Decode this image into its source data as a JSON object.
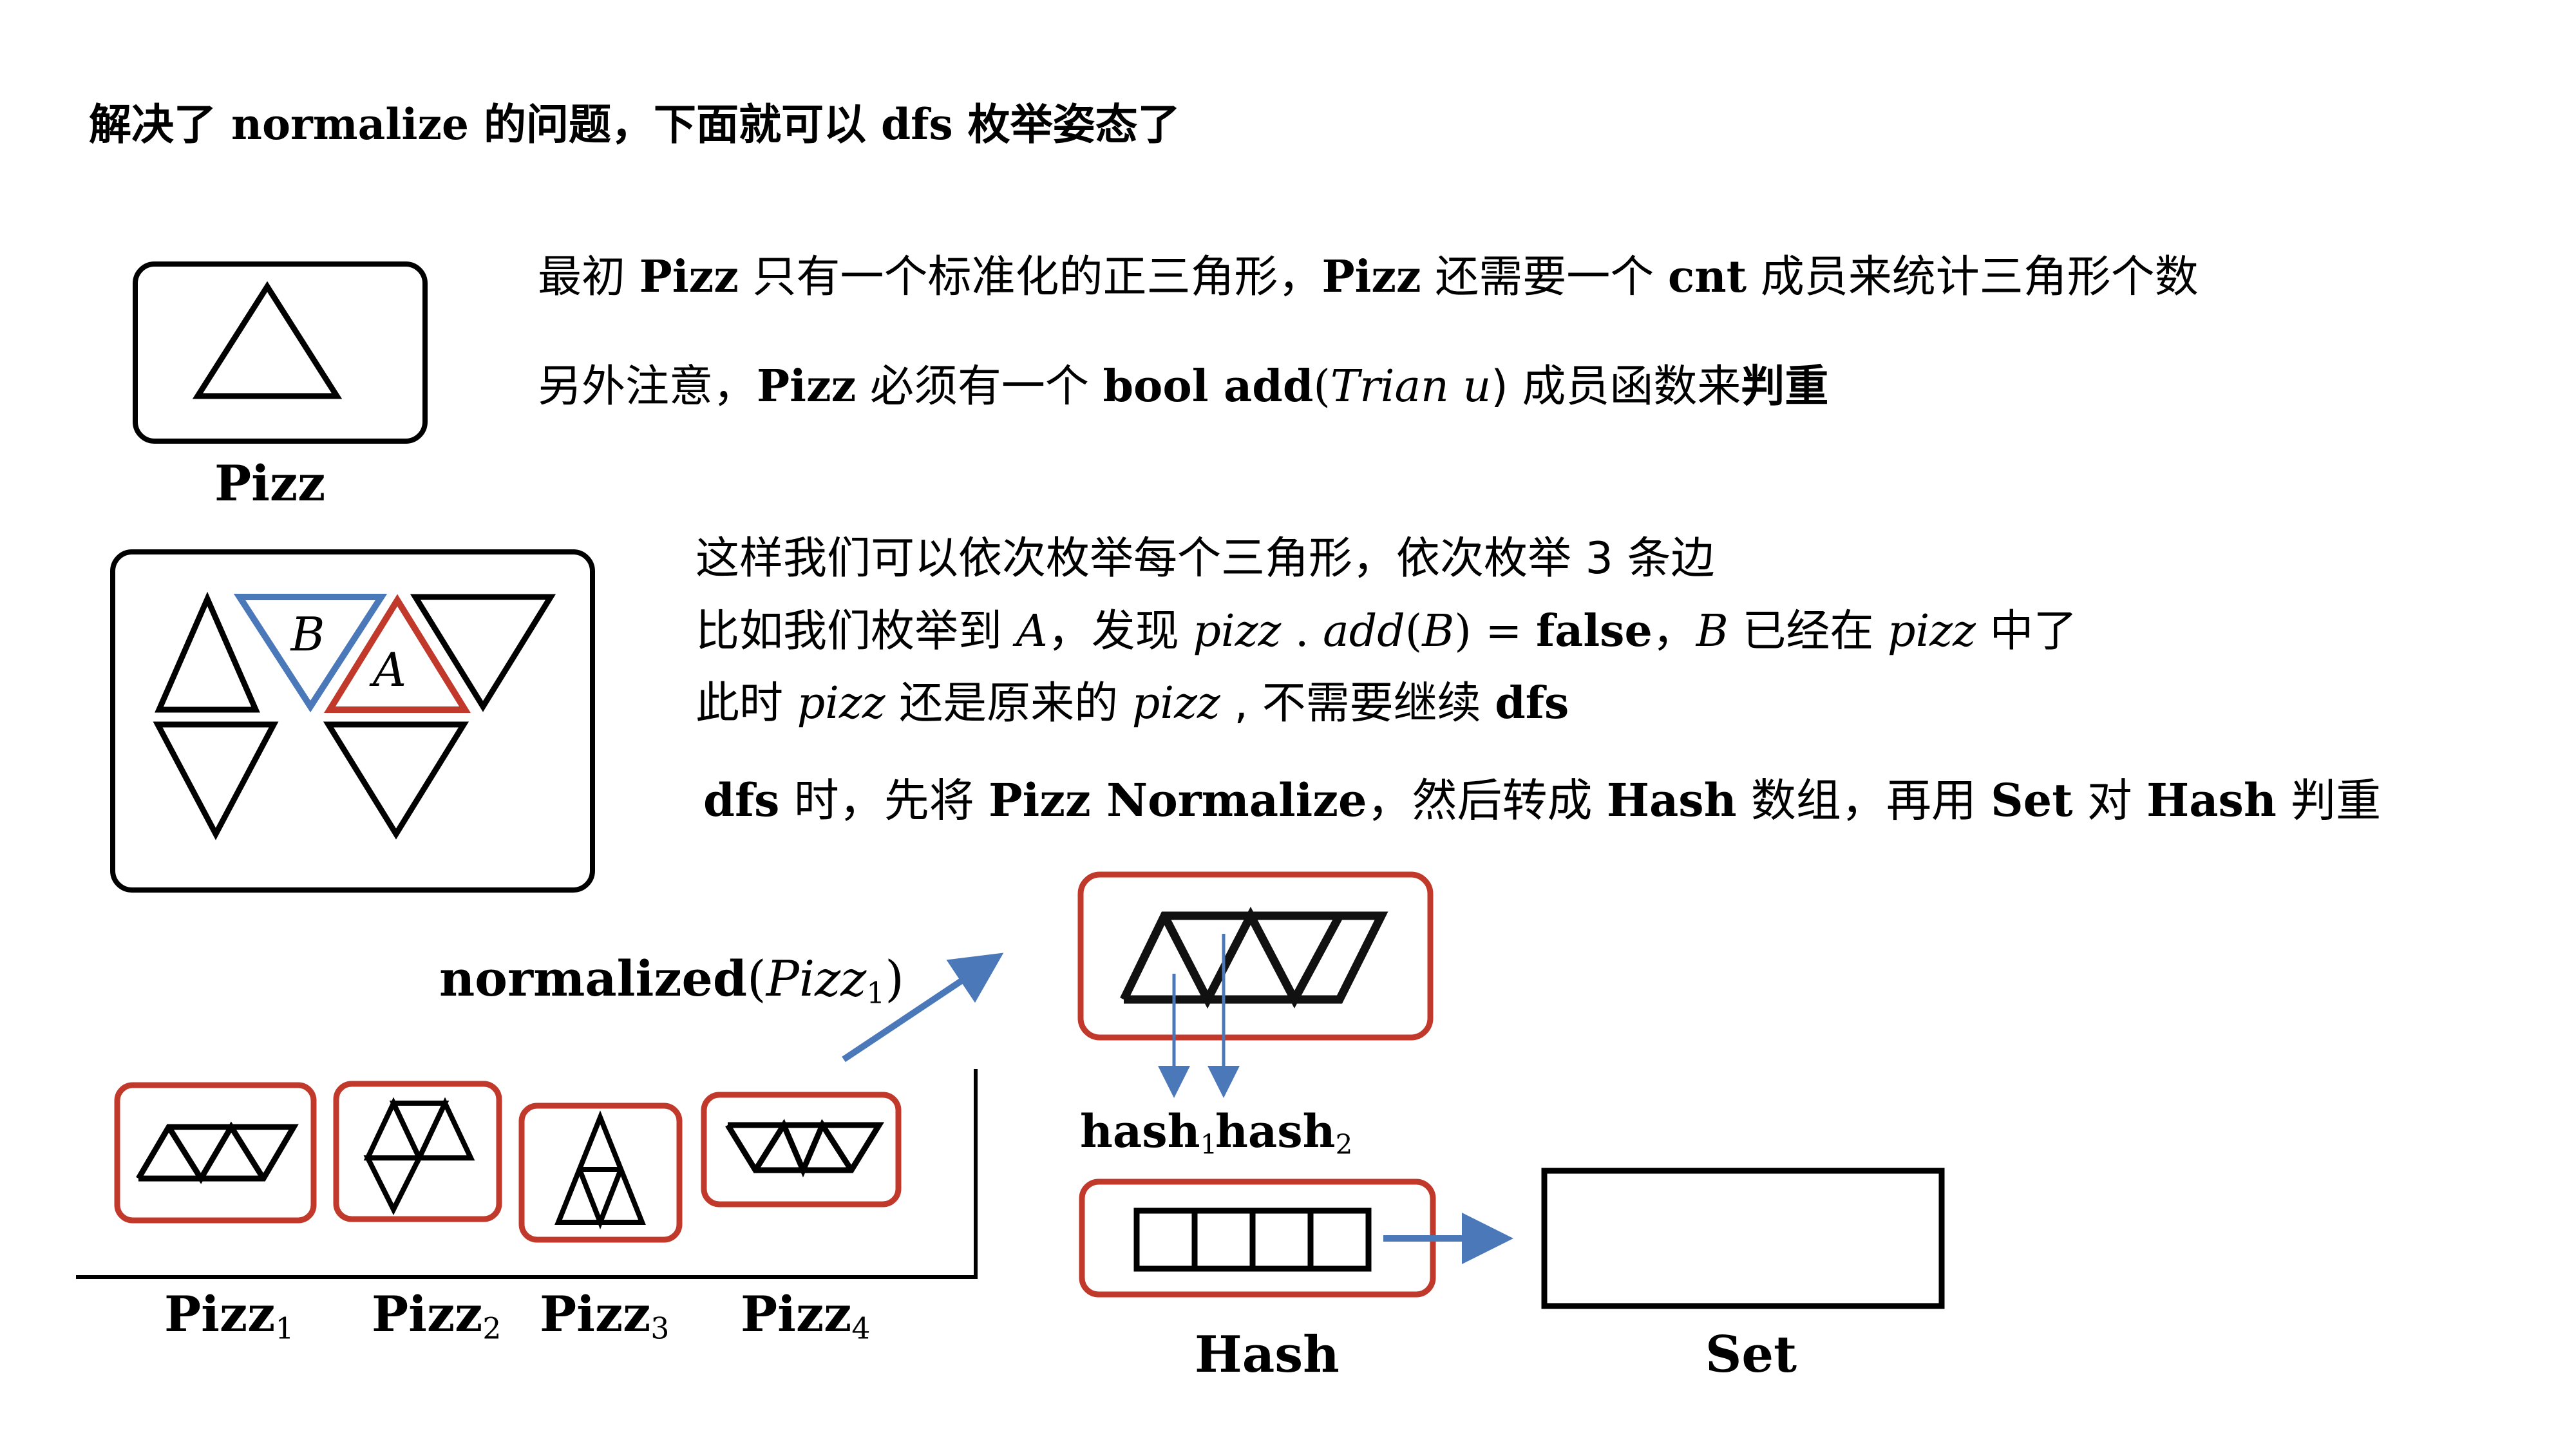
{
  "title": {
    "p1": "解决了 ",
    "k1": "normalize",
    "p2": " 的问题，下面就可以 ",
    "k2": "dfs",
    "p3": " 枚举姿态了"
  },
  "pizz_box": {
    "label": "Pizz"
  },
  "desc": {
    "line1": {
      "p1": "最初 ",
      "k1": "Pizz",
      "p2": " 只有一个标准化的正三角形，",
      "k2": "Pizz",
      "p3": " 还需要一个 ",
      "k3": "cnt",
      "p4": " 成员来统计三角形个数"
    },
    "line2": {
      "p1": "另外注意，",
      "k1": "Pizz",
      "p2": " 必须有一个 ",
      "k2": "bool add",
      "p3": "(",
      "i1": "Trian u",
      "p4": ") 成员函数来",
      "k3": "判重"
    }
  },
  "enum_box": {
    "label_b": "B",
    "label_a": "A"
  },
  "enum_text": {
    "line1": "这样我们可以依次枚举每个三角形，依次枚举 3 条边",
    "line2": {
      "p1": "比如我们枚举到 ",
      "i1": "A",
      "p2": "，发现 ",
      "i2": "pizz",
      "p3": " . ",
      "i3": "add",
      "p4": "(",
      "i4": "B",
      "p5": ") = ",
      "k1": "false",
      "p6": "，",
      "i5": "B",
      "p7": " 已经在 ",
      "i6": "pizz",
      "p8": " 中了"
    },
    "line3": {
      "p1": "此时 ",
      "i1": "pizz",
      "p2": " 还是原来的 ",
      "i2": "pizz",
      "p3": " , 不需要继续 ",
      "k1": "dfs"
    },
    "line4": {
      "k1": "dfs",
      "p1": " 时，先将 ",
      "k2": "Pizz Normalize",
      "p2": "，然后转成 ",
      "k3": "Hash",
      "p3": " 数组，再用 ",
      "k4": "Set",
      "p4": " 对 ",
      "k5": "Hash",
      "p5": " 判重"
    }
  },
  "normalized_label": {
    "k1": "normalized",
    "p1": "(",
    "i1": "Pizz",
    "sub": "1",
    "p2": ")"
  },
  "pizz_items": [
    {
      "name": "Pizz",
      "sub": "1"
    },
    {
      "name": "Pizz",
      "sub": "2"
    },
    {
      "name": "Pizz",
      "sub": "3"
    },
    {
      "name": "Pizz",
      "sub": "4"
    }
  ],
  "hash_labels": [
    {
      "name": "hash",
      "sub": "1"
    },
    {
      "name": "hash",
      "sub": "2"
    }
  ],
  "hash_box": {
    "label": "Hash"
  },
  "set_box": {
    "label": "Set"
  },
  "colors": {
    "red": "#c0392b",
    "blue": "#4a78b8",
    "black": "#000000"
  }
}
